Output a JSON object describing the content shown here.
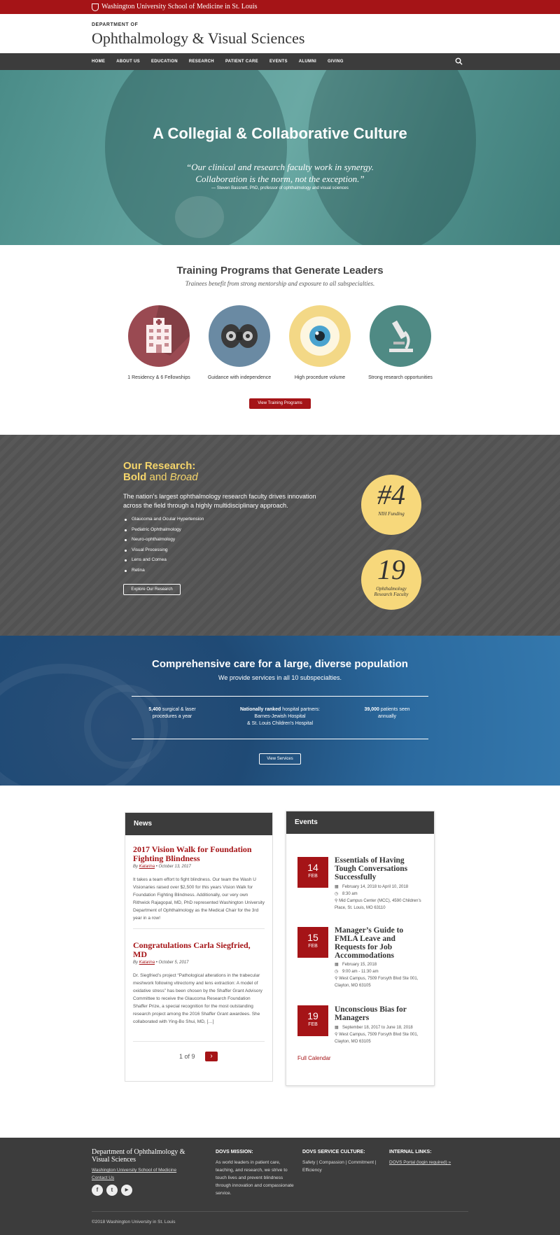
{
  "topbar": {
    "university": "Washington University School of Medicine in St. Louis"
  },
  "header": {
    "eyebrow": "DEPARTMENT OF",
    "title": "Ophthalmology & Visual Sciences"
  },
  "nav": {
    "items": [
      "HOME",
      "ABOUT US",
      "EDUCATION",
      "RESEARCH",
      "PATIENT CARE",
      "EVENTS",
      "ALUMNI",
      "GIVING"
    ]
  },
  "hero": {
    "title": "A Collegial & Collaborative Culture",
    "quote_line1": "“Our clinical and research faculty work in synergy.",
    "quote_line2": "Collaboration is the norm, not the exception.”",
    "cite": "— Steven Bassnett, PhD, professor of ophthalmology and visual sciences"
  },
  "training": {
    "title": "Training Programs that Generate Leaders",
    "subtitle": "Trainees benefit from strong mentorship and exposure to all subspecialties.",
    "items": [
      {
        "label": "1 Residency & 6 Fellowships",
        "icon": "hospital-icon",
        "color": "#9a4a52"
      },
      {
        "label": "Guidance with independence",
        "icon": "binocular-icon",
        "color": "#6a8aa3"
      },
      {
        "label": "High procedure volume",
        "icon": "eye-icon",
        "color": "#f3d886"
      },
      {
        "label": "Strong research opportunities",
        "icon": "microscope-icon",
        "color": "#4f8a84"
      }
    ],
    "button": "View Training Programs"
  },
  "research": {
    "heading_line1": "Our Research:",
    "heading_bold": "Bold",
    "heading_and": "and",
    "heading_italic": "Broad",
    "lead": "The nation’s largest ophthalmology research faculty drives innovation across the field through a highly multidisciplinary approach.",
    "areas": [
      "Glaucoma and Ocular Hypertension",
      "Pediatric Ophthalmology",
      "Neuro-ophthalmology",
      "Visual Processing",
      "Lens and Cornea",
      "Retina"
    ],
    "button": "Explore Our Research",
    "stat1_big": "#4",
    "stat1_small": "NIH Funding",
    "stat2_big": "19",
    "stat2_small_1": "Ophthalmology",
    "stat2_small_2": "Research Faculty"
  },
  "care": {
    "title": "Comprehensive care for a large, diverse population",
    "subtitle": "We provide services in all 10 subspecialties.",
    "stat1_num": "5,400",
    "stat1_rest": "surgical & laser",
    "stat1_line2": "procedures a year",
    "stat2_bold": "Nationally ranked",
    "stat2_rest": "hospital partners:",
    "stat2_line2": "Barnes-Jewish Hospital",
    "stat2_line3": "& St. Louis Children’s Hospital",
    "stat3_num": "39,000",
    "stat3_rest": "patients seen",
    "stat3_line2": "annually",
    "button": "View Services"
  },
  "news": {
    "heading": "News",
    "posts": [
      {
        "title": "2017 Vision Walk for Foundation Fighting Blindness",
        "by": "By",
        "author": "Katarina",
        "date": "October 13, 2017",
        "body": "It takes a team effort to fight blindness. Our team the Wash U Visionaries raised over $2,500 for this years Vision Walk for Foundation Fighting Blindness. Additionally, our very own Rithwick Rajagopal, MD, PhD represented Washington University Department of Ophthalmology as the Medical Chair for the 3rd year in a row!"
      },
      {
        "title": "Congratulations Carla Siegfried, MD",
        "by": "By",
        "author": "Katarina",
        "date": "October 5, 2017",
        "body": "Dr. Siegfried’s project “Pathological alterations in the trabecular meshwork following vitrectomy and lens extraction: A model of oxidative stress” has been chosen by the Shaffer Grant Advisory Committee to receive the Glaucoma Research Foundation Shaffer Prize, a special recognition for the most outstanding research project among the 2016 Shaffer Grant awardees. She collaborated with Ying-Bo Shui, MD, […]"
      }
    ],
    "pager": "1 of 9",
    "next": "›"
  },
  "events": {
    "heading": "Events",
    "items": [
      {
        "day": "14",
        "month": "FEB",
        "title": "Essentials of Having Tough Conversations Successfully",
        "dates": "February 14, 2018 to April 10, 2018",
        "time": "8:30 am",
        "location": "Mid Campus Center (MCC), 4590 Children’s Place, St. Louis, MO 63110"
      },
      {
        "day": "15",
        "month": "FEB",
        "title": "Manager’s Guide to FMLA Leave and Requests for Job Accommodations",
        "dates": "February 15, 2018",
        "time": "9:00 am - 11:30 am",
        "location": "West Campus, 7509 Forsyth Blvd Ste 001, Clayton, MO 63105"
      },
      {
        "day": "19",
        "month": "FEB",
        "title": "Unconscious Bias for Managers",
        "dates": "September 18, 2017 to June 18, 2018",
        "time": "",
        "location": "West Campus, 7509 Forsyth Blvd Ste 001, Clayton, MO 63105"
      }
    ],
    "full_calendar": "Full Calendar"
  },
  "footer": {
    "title_line1": "Department of Ophthalmology &",
    "title_line2": "Visual Sciences",
    "link1": "Washington University School of Medicine",
    "link2": "Contact Us",
    "social": [
      "f",
      "t",
      "▶"
    ],
    "mission_heading": "DOVS MISSION:",
    "mission_text": "As world leaders in patient care, teaching, and research, we strive to touch lives and prevent blindness through innovation and compassionate service.",
    "culture_heading": "DOVS SERVICE CULTURE:",
    "culture_text": "Safety | Compassion | Commitment | Efficiency",
    "links_heading": "INTERNAL LINKS:",
    "portal_link": "DOVS Portal (login required) »",
    "copyright": "©2018 Washington University in St. Louis"
  }
}
